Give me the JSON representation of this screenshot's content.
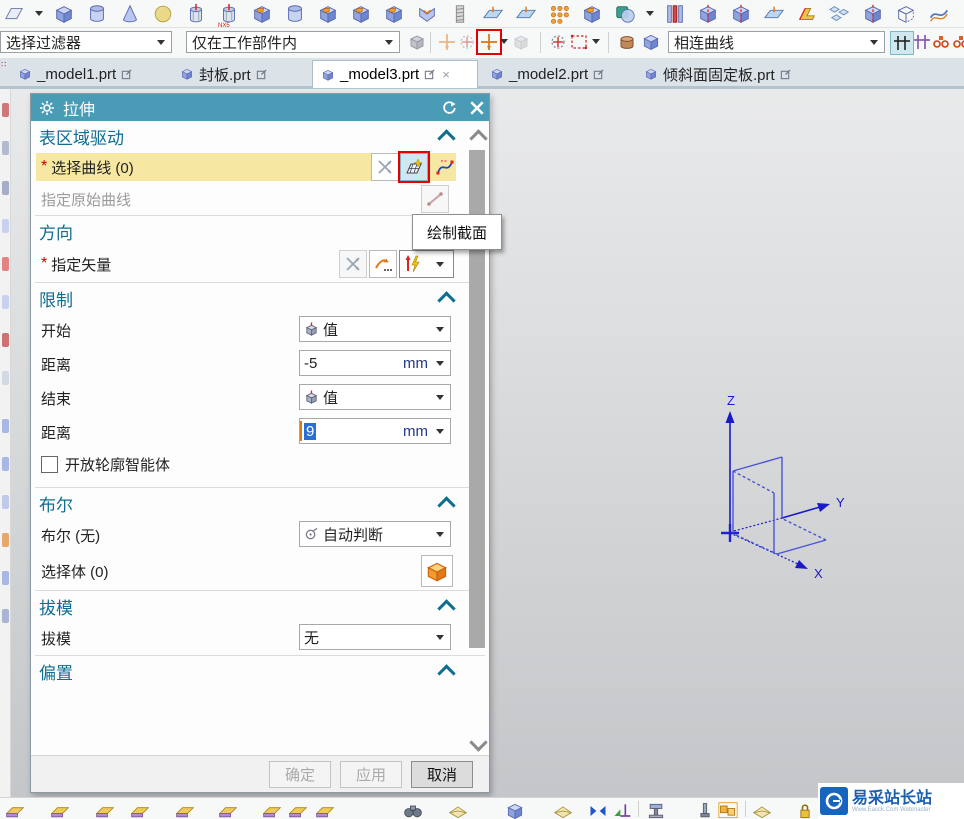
{
  "toolbar_top": {
    "nx5_badge": "NX5",
    "icons": [
      "datum-plane",
      "block",
      "cylinder",
      "cone",
      "sphere",
      "hole",
      "hole-nx5",
      "boss",
      "pad",
      "cube-hole",
      "cube-slot",
      "cube-pocket",
      "emboss",
      "thread",
      "sheet-arrow",
      "sheet-stack",
      "pattern-feature",
      "mirror-body",
      "unite-boolean",
      "rib",
      "trim-body",
      "split-body",
      "offset-surface",
      "bend",
      "lattice",
      "trimmed-sheet",
      "bounded-plane",
      "swept-sheet"
    ]
  },
  "toolbar_selection": {
    "filter_combo": "选择过滤器",
    "scope_combo": "仅在工作部件内",
    "curve_rule_combo": "相连曲线",
    "icons": [
      "assembly-constraints",
      "snap-point-gray",
      "snap-rotate-gray",
      "snap-point-highlight",
      "snap-pair-1",
      "snap-pair-2",
      "snap-circle-center",
      "rectangle-select",
      "shaded-tool",
      "cube-tool",
      "stop-at-intersection-selected",
      "stop-at-intersection-alt",
      "follow-fillet",
      "chain-partial"
    ]
  },
  "tabs": [
    {
      "label": "_model1.prt",
      "active": false
    },
    {
      "label": "封板.prt",
      "active": false
    },
    {
      "label": "_model3.prt",
      "active": true,
      "close": "×"
    },
    {
      "label": "_model2.prt",
      "active": false
    },
    {
      "label": "倾斜面固定板.prt",
      "active": false
    }
  ],
  "dialog": {
    "title": "拉伸",
    "section_region": {
      "title": "表区域驱动",
      "asterisk": "*",
      "select_curve": "选择曲线 (0)",
      "specify_original": "指定原始曲线"
    },
    "direction": {
      "title": "方向",
      "asterisk": "*",
      "specify_vector": "指定矢量"
    },
    "limits": {
      "title": "限制",
      "start_label": "开始",
      "start_mode": "值",
      "dist1_label": "距离",
      "dist1_value": "-5",
      "unit1": "mm",
      "end_label": "结束",
      "end_mode": "值",
      "dist2_label": "距离",
      "dist2_value": "9",
      "unit2": "mm",
      "open_profile_checkbox": "开放轮廓智能体"
    },
    "boolean": {
      "title": "布尔",
      "label": "布尔 (无)",
      "mode": "自动判断",
      "select_body": "选择体 (0)"
    },
    "draft": {
      "title": "拔模",
      "label": "拔模",
      "mode": "无"
    },
    "offset": {
      "title": "偏置"
    },
    "buttons": {
      "ok": "确定",
      "apply": "应用",
      "cancel": "取消"
    }
  },
  "tooltip": {
    "text": "绘制截面"
  },
  "viewport": {
    "axis_labels": {
      "x": "X",
      "y": "Y",
      "z": "Z"
    }
  },
  "bottom_toolbar": {
    "icons": [
      "flange",
      "contour-flange",
      "sheet-tab",
      "bend-sheet",
      "dimple",
      "louver",
      "cutout",
      "normal-cutout",
      "bead",
      "find-binoculars",
      "render-style",
      "cube-add",
      "envelope-unfold",
      "bowtie-mirror",
      "perpendicular-snap",
      "clamp",
      "pin",
      "pattern-squares",
      "flat-sheet",
      "lock"
    ]
  },
  "watermark": {
    "title": "易采站长站",
    "subtitle": "Www.Easck.Com Webmaster"
  },
  "accent_colors": {
    "dialog_titlebar": "#4a9cb6",
    "section_header": "#0e6d92",
    "required_highlight": "#f6e8a2",
    "annotation_red": "#e30000",
    "selection_blue": "#2a6fd6"
  }
}
